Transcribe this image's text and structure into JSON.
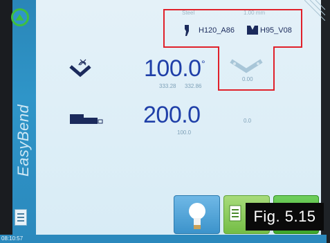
{
  "sidebar": {
    "brand": "EasyBend"
  },
  "status": {
    "clock": "08:10:57"
  },
  "tooling": {
    "material": "Steel",
    "thickness": "1.00 mm",
    "punch": "H120_A86",
    "die": "H95_V08"
  },
  "angle": {
    "value": "100.0",
    "unit": "°",
    "sub_left": "333.28",
    "sub_right": "332.86",
    "correction": "0.00"
  },
  "backgauge": {
    "value": "200.0",
    "sub": "100.0",
    "retract": "0.0"
  },
  "figure_label": "Fig. 5.15",
  "colors": {
    "sidebar": "#2f95c8",
    "value_text": "#1f3fa8",
    "highlight": "#e0202a",
    "button_blue": "#3c93cb",
    "button_green": "#74bd46"
  }
}
